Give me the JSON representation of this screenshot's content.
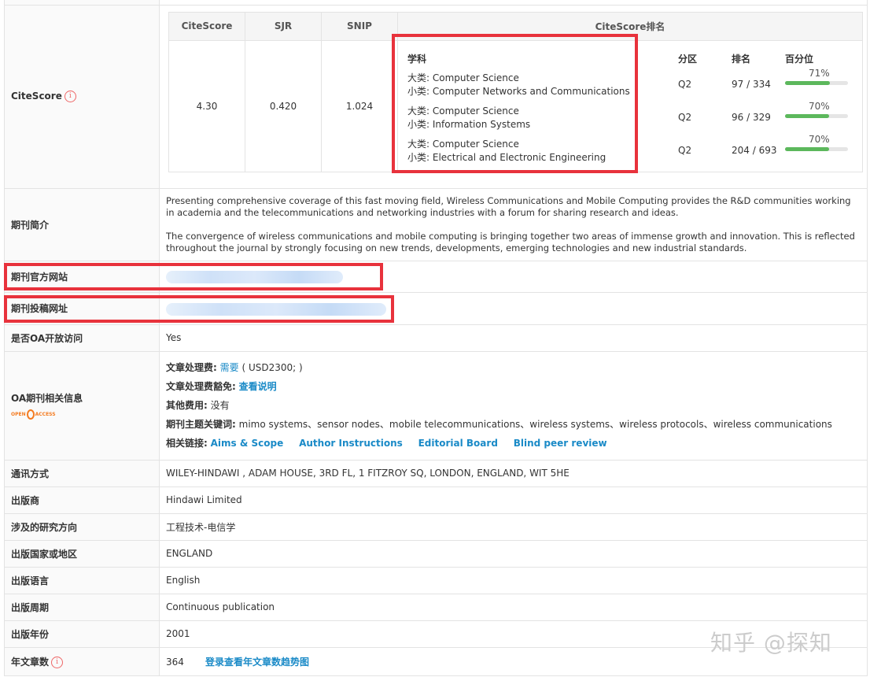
{
  "citescore": {
    "label": "CiteScore",
    "headers": [
      "CiteScore",
      "SJR",
      "SNIP",
      "CiteScore排名"
    ],
    "values": {
      "citescore": "4.30",
      "sjr": "0.420",
      "snip": "1.024"
    },
    "rank_headers": {
      "subject": "学科",
      "zone": "分区",
      "rank": "排名",
      "percentile": "百分位"
    },
    "rows": [
      {
        "major_label": "大类:",
        "major": "Computer Science",
        "minor_label": "小类:",
        "minor": "Computer Networks and Communications",
        "zone": "Q2",
        "rank": "97 / 334",
        "percent_text": "71%",
        "percent": 71
      },
      {
        "major_label": "大类:",
        "major": "Computer Science",
        "minor_label": "小类:",
        "minor": "Information Systems",
        "zone": "Q2",
        "rank": "96 / 329",
        "percent_text": "70%",
        "percent": 70
      },
      {
        "major_label": "大类:",
        "major": "Computer Science",
        "minor_label": "小类:",
        "minor": "Electrical and Electronic Engineering",
        "zone": "Q2",
        "rank": "204 / 693",
        "percent_text": "70%",
        "percent": 70
      }
    ]
  },
  "intro": {
    "label": "期刊简介",
    "p1": "Presenting comprehensive coverage of this fast moving field, Wireless Communications and Mobile Computing provides the R&D communities working in academia and the telecommunications and networking industries with a forum for sharing research and ideas.",
    "p2": "The convergence of wireless communications and mobile computing is bringing together two areas of immense growth and innovation. This is reflected throughout the journal by strongly focusing on new trends, developments, emerging technologies and new industrial standards."
  },
  "website": {
    "label": "期刊官方网站"
  },
  "submission": {
    "label": "期刊投稿网址"
  },
  "oa_access": {
    "label": "是否OA开放访问",
    "value": "Yes"
  },
  "oa_info": {
    "label": "OA期刊相关信息",
    "logo_text": "OPEN ACCESS",
    "apc_label": "文章处理费:",
    "apc_value": "需要",
    "apc_amount": "( USD2300; )",
    "waiver_label": "文章处理费豁免:",
    "waiver_link": "查看说明",
    "other_label": "其他费用:",
    "other_value": "没有",
    "keywords_label": "期刊主题关键词:",
    "keywords": "mimo systems、sensor nodes、mobile telecommunications、wireless systems、wireless protocols、wireless communications",
    "links_label": "相关链接:",
    "links": [
      "Aims & Scope",
      "Author Instructions",
      "Editorial Board",
      "Blind peer review"
    ]
  },
  "contact": {
    "label": "通讯方式",
    "value": "WILEY-HINDAWI , ADAM HOUSE, 3RD FL, 1 FITZROY SQ, LONDON, ENGLAND, WIT 5HE"
  },
  "publisher": {
    "label": "出版商",
    "value": "Hindawi Limited"
  },
  "research": {
    "label": "涉及的研究方向",
    "value": "工程技术-电信学"
  },
  "country": {
    "label": "出版国家或地区",
    "value": "ENGLAND"
  },
  "language": {
    "label": "出版语言",
    "value": "English"
  },
  "frequency": {
    "label": "出版周期",
    "value": "Continuous publication"
  },
  "year": {
    "label": "出版年份",
    "value": "2001"
  },
  "articles": {
    "label": "年文章数",
    "value": "364",
    "link": "登录查看年文章数趋势图"
  },
  "watermark": "知乎 @探知",
  "colors": {
    "highlight_red": "#e8323c",
    "link_blue": "#1a8ac7",
    "bar_green": "#5cb85c"
  }
}
